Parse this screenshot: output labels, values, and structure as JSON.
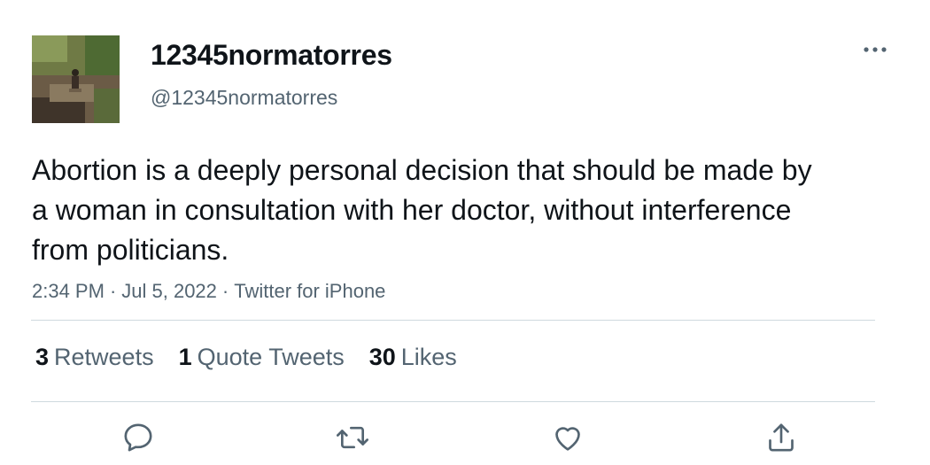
{
  "tweet": {
    "display_name": "12345normatorres",
    "handle": "@12345normatorres",
    "text": "Abortion is a deeply personal decision that should be made by a woman in consultation with her doctor, without interference from politicians.",
    "time": "2:34 PM",
    "date": "Jul 5, 2022",
    "source": "Twitter for iPhone",
    "separator": "·"
  },
  "stats": {
    "retweets": {
      "count": "3",
      "label": "Retweets"
    },
    "quotes": {
      "count": "1",
      "label": "Quote Tweets"
    },
    "likes": {
      "count": "30",
      "label": "Likes"
    }
  },
  "icons": {
    "more": "more-horizontal-icon",
    "reply": "reply-icon",
    "retweet": "retweet-icon",
    "like": "heart-icon",
    "share": "share-icon"
  },
  "colors": {
    "text": "#0f1419",
    "secondary": "#536471",
    "divider": "#cfd9de"
  }
}
